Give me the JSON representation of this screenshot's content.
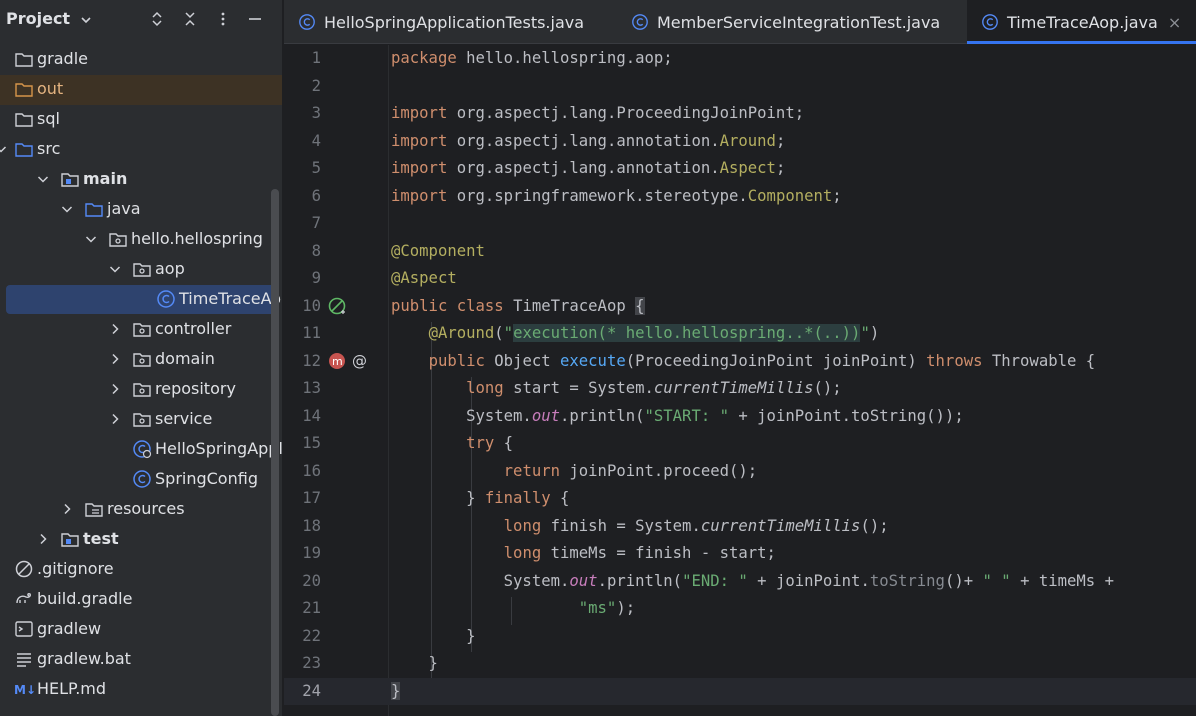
{
  "project_panel": {
    "title": "Project",
    "tree": [
      {
        "label": "gradle",
        "depth": 0,
        "icon": "folder-icon",
        "expander": "none"
      },
      {
        "label": "out",
        "depth": 0,
        "icon": "folder-icon-orange",
        "expander": "none"
      },
      {
        "label": "sql",
        "depth": 0,
        "icon": "folder-icon",
        "expander": "none"
      },
      {
        "label": "src",
        "depth": 0,
        "icon": "folder-icon-blue",
        "expander": "expanded"
      },
      {
        "label": "main",
        "depth": 1,
        "icon": "source-root-icon",
        "expander": "expanded"
      },
      {
        "label": "java",
        "depth": 2,
        "icon": "folder-icon-blue",
        "expander": "expanded"
      },
      {
        "label": "hello.hellospring",
        "depth": 3,
        "icon": "package-icon",
        "expander": "expanded"
      },
      {
        "label": "aop",
        "depth": 4,
        "icon": "package-icon",
        "expander": "expanded"
      },
      {
        "label": "TimeTraceAop",
        "depth": 5,
        "icon": "class-icon",
        "expander": "none",
        "selected": true
      },
      {
        "label": "controller",
        "depth": 4,
        "icon": "package-icon",
        "expander": "collapsed"
      },
      {
        "label": "domain",
        "depth": 4,
        "icon": "package-icon",
        "expander": "collapsed"
      },
      {
        "label": "repository",
        "depth": 4,
        "icon": "package-icon",
        "expander": "collapsed"
      },
      {
        "label": "service",
        "depth": 4,
        "icon": "package-icon",
        "expander": "collapsed"
      },
      {
        "label": "HelloSpringApplicat",
        "depth": 4,
        "icon": "spring-boot-class-icon",
        "expander": "none"
      },
      {
        "label": "SpringConfig",
        "depth": 4,
        "icon": "class-icon",
        "expander": "none"
      },
      {
        "label": "resources",
        "depth": 2,
        "icon": "resources-folder-icon",
        "expander": "collapsed"
      },
      {
        "label": "test",
        "depth": 1,
        "icon": "source-root-icon",
        "expander": "collapsed"
      },
      {
        "label": ".gitignore",
        "depth": 0,
        "icon": "gitignore-icon",
        "expander": "none"
      },
      {
        "label": "build.gradle",
        "depth": 0,
        "icon": "gradle-icon",
        "expander": "none"
      },
      {
        "label": "gradlew",
        "depth": 0,
        "icon": "terminal-file-icon",
        "expander": "none"
      },
      {
        "label": "gradlew.bat",
        "depth": 0,
        "icon": "text-file-icon",
        "expander": "none"
      },
      {
        "label": "HELP.md",
        "depth": 0,
        "icon": "markdown-icon",
        "expander": "none"
      }
    ]
  },
  "tabs": [
    {
      "label": "HelloSpringApplicationTests.java",
      "active": false
    },
    {
      "label": "MemberServiceIntegrationTest.java",
      "active": false
    },
    {
      "label": "TimeTraceAop.java",
      "active": true
    }
  ],
  "editor": {
    "current_line": 24,
    "lines": [
      {
        "n": "1",
        "tokens": [
          [
            "kw",
            "package"
          ],
          [
            "cls",
            " hello.hellospring.aop;"
          ]
        ]
      },
      {
        "n": "2",
        "tokens": []
      },
      {
        "n": "3",
        "tokens": [
          [
            "kw",
            "import"
          ],
          [
            "cls",
            " org.aspectj.lang.ProceedingJoinPoint;"
          ]
        ]
      },
      {
        "n": "4",
        "tokens": [
          [
            "kw",
            "import"
          ],
          [
            "cls",
            " org.aspectj.lang.annotation."
          ],
          [
            "ann",
            "Around"
          ],
          [
            "cls",
            ";"
          ]
        ]
      },
      {
        "n": "5",
        "tokens": [
          [
            "kw",
            "import"
          ],
          [
            "cls",
            " org.aspectj.lang.annotation."
          ],
          [
            "ann",
            "Aspect"
          ],
          [
            "cls",
            ";"
          ]
        ]
      },
      {
        "n": "6",
        "tokens": [
          [
            "kw",
            "import"
          ],
          [
            "cls",
            " org.springframework.stereotype."
          ],
          [
            "ann",
            "Component"
          ],
          [
            "cls",
            ";"
          ]
        ]
      },
      {
        "n": "7",
        "tokens": []
      },
      {
        "n": "8",
        "tokens": [
          [
            "ann",
            "@Component"
          ]
        ]
      },
      {
        "n": "9",
        "tokens": [
          [
            "ann",
            "@Aspect"
          ]
        ]
      },
      {
        "n": "10",
        "tokens": [
          [
            "kw",
            "public class "
          ],
          [
            "cls",
            "TimeTraceAop "
          ],
          [
            "brace",
            "{"
          ]
        ],
        "gutter": "bean-icon"
      },
      {
        "n": "11",
        "tokens": [
          [
            "cls",
            "    "
          ],
          [
            "ann",
            "@Around"
          ],
          [
            "cls",
            "("
          ],
          [
            "str",
            "\""
          ],
          [
            "hl",
            "execution(* hello.hellospring..*(..))"
          ],
          [
            "str",
            "\""
          ],
          [
            "cls",
            ")"
          ]
        ]
      },
      {
        "n": "12",
        "tokens": [
          [
            "cls",
            "    "
          ],
          [
            "kw",
            "public "
          ],
          [
            "cls",
            "Object "
          ],
          [
            "fn",
            "execute"
          ],
          [
            "cls",
            "(ProceedingJoinPoint joinPoint) "
          ],
          [
            "kw",
            "throws "
          ],
          [
            "cls",
            "Throwable {"
          ]
        ],
        "gutter": "advice-icon"
      },
      {
        "n": "13",
        "tokens": [
          [
            "cls",
            "        "
          ],
          [
            "kw",
            "long "
          ],
          [
            "cls",
            "start = System."
          ],
          [
            "it",
            "currentTimeMillis"
          ],
          [
            "cls",
            "();"
          ]
        ]
      },
      {
        "n": "14",
        "tokens": [
          [
            "cls",
            "        System."
          ],
          [
            "sf",
            "out"
          ],
          [
            "cls",
            ".println("
          ],
          [
            "str",
            "\"START: \""
          ],
          [
            "cls",
            " + joinPoint.toString());"
          ]
        ]
      },
      {
        "n": "15",
        "tokens": [
          [
            "cls",
            "        "
          ],
          [
            "kw",
            "try "
          ],
          [
            "cls",
            "{"
          ]
        ]
      },
      {
        "n": "16",
        "tokens": [
          [
            "cls",
            "            "
          ],
          [
            "kw",
            "return "
          ],
          [
            "cls",
            "joinPoint.proceed();"
          ]
        ]
      },
      {
        "n": "17",
        "tokens": [
          [
            "cls",
            "        } "
          ],
          [
            "kw",
            "finally "
          ],
          [
            "cls",
            "{"
          ]
        ]
      },
      {
        "n": "18",
        "tokens": [
          [
            "cls",
            "            "
          ],
          [
            "kw",
            "long "
          ],
          [
            "cls",
            "finish = System."
          ],
          [
            "it",
            "currentTimeMillis"
          ],
          [
            "cls",
            "();"
          ]
        ]
      },
      {
        "n": "19",
        "tokens": [
          [
            "cls",
            "            "
          ],
          [
            "kw",
            "long "
          ],
          [
            "cls",
            "timeMs = finish - start;"
          ]
        ]
      },
      {
        "n": "20",
        "tokens": [
          [
            "cls",
            "            System."
          ],
          [
            "sf",
            "out"
          ],
          [
            "cls",
            ".println("
          ],
          [
            "str",
            "\"END: \""
          ],
          [
            "cls",
            " + joinPoint."
          ],
          [
            "dim",
            "toString"
          ],
          [
            "cls",
            "()+ "
          ],
          [
            "str",
            "\" \""
          ],
          [
            "cls",
            " + timeMs +"
          ]
        ]
      },
      {
        "n": "21",
        "tokens": [
          [
            "cls",
            "                    "
          ],
          [
            "str",
            "\"ms\""
          ],
          [
            "cls",
            ");"
          ]
        ]
      },
      {
        "n": "22",
        "tokens": [
          [
            "cls",
            "        }"
          ]
        ]
      },
      {
        "n": "23",
        "tokens": [
          [
            "cls",
            "    }"
          ]
        ]
      },
      {
        "n": "24",
        "tokens": [
          [
            "brace",
            "}"
          ]
        ]
      }
    ]
  },
  "colors": {
    "accent": "#3574f0",
    "selection": "#2e436e",
    "keyword": "#cf8e6d",
    "annotation": "#b3ae60",
    "string": "#6aab73"
  }
}
